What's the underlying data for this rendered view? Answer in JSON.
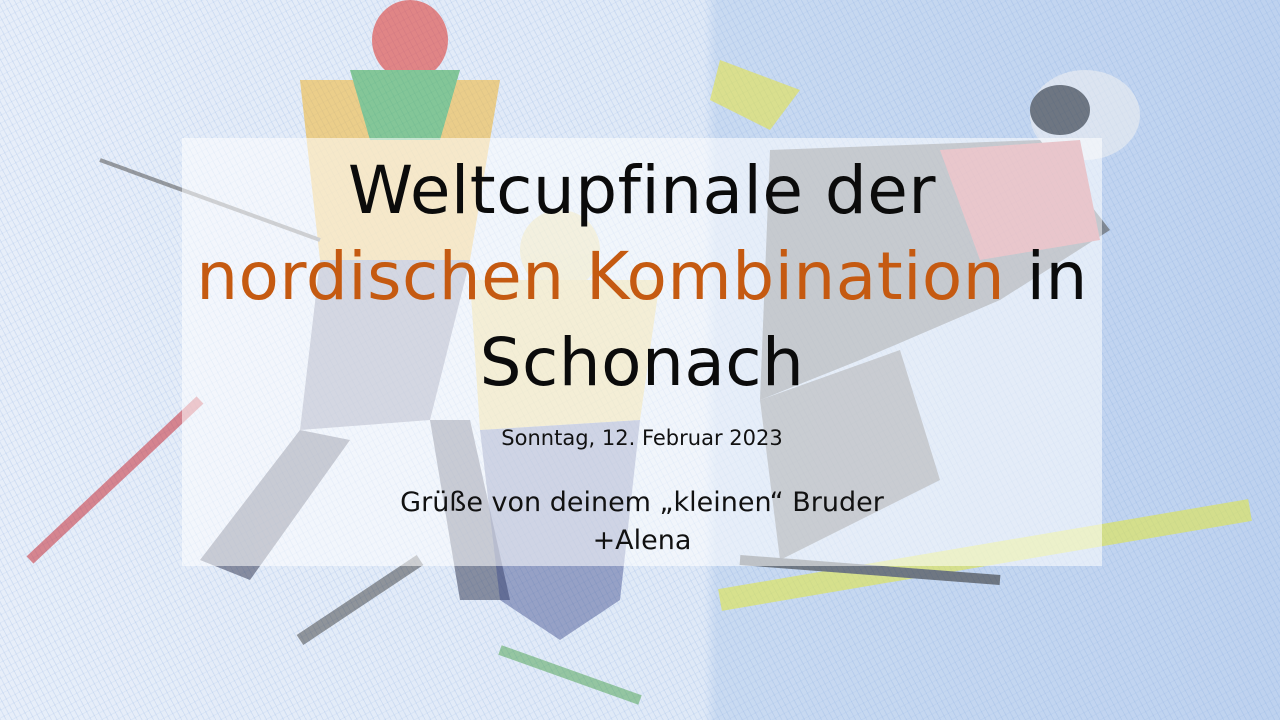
{
  "slide": {
    "title_part1": "Weltcupfinale der",
    "title_accent": "nordischen Kombination",
    "title_part2": " in",
    "title_part3": "Schonach",
    "date": "Sonntag, 12. Februar 2023",
    "greeting_line1": "Grüße von deinem „kleinen“ Bruder",
    "greeting_line2": "+Alena"
  },
  "colors": {
    "accent": "#c55a11",
    "text": "#0b0b0b"
  }
}
